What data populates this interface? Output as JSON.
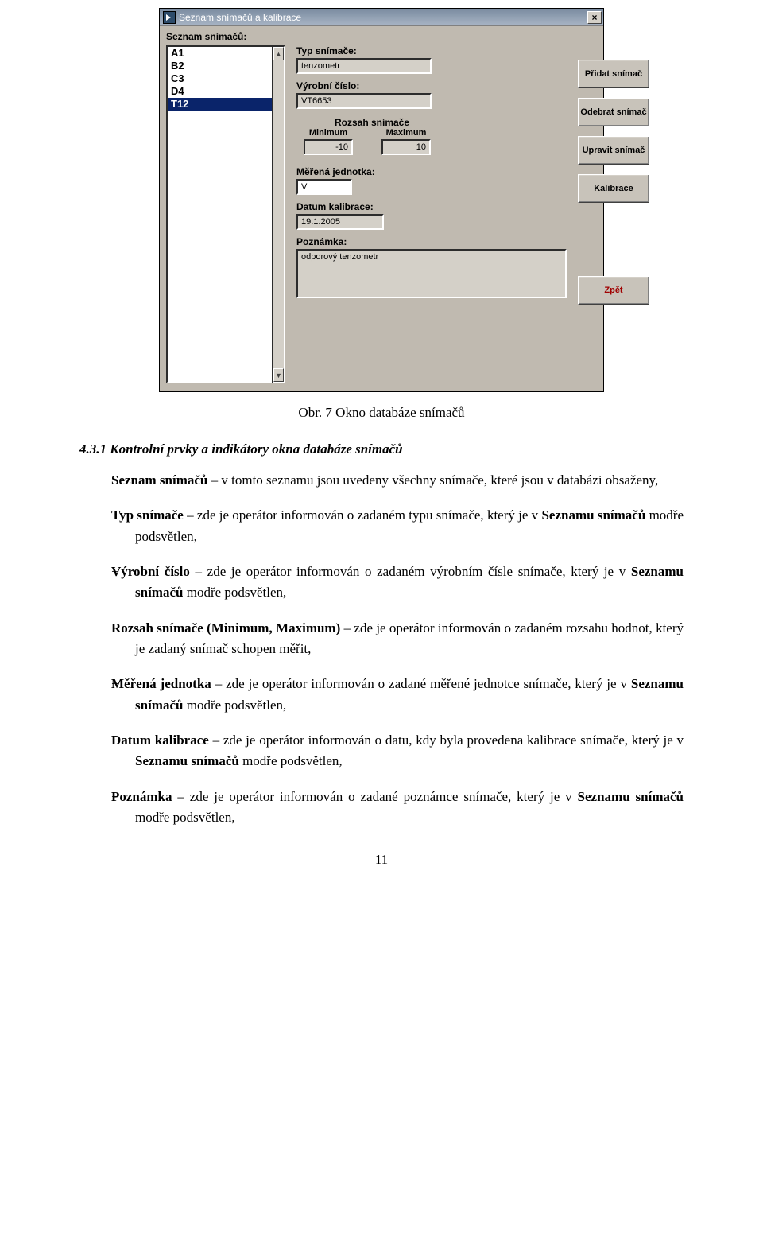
{
  "window": {
    "title": "Seznam snímačů a kalibrace",
    "close_glyph": "×",
    "list_label": "Seznam snímačů:",
    "items": [
      "A1",
      "B2",
      "C3",
      "D4",
      "T12"
    ],
    "selected_index": 4,
    "fields": {
      "typ_label": "Typ snímače:",
      "typ_value": "tenzometr",
      "vyrobni_label": "Výrobní číslo:",
      "vyrobni_value": "VT6653",
      "rozsah_label": "Rozsah snímače",
      "min_label": "Minimum",
      "max_label": "Maximum",
      "min_value": "-10",
      "max_value": "10",
      "jednotka_label": "Měřená jednotka:",
      "jednotka_value": "V",
      "datum_label": "Datum kalibrace:",
      "datum_value": "19.1.2005",
      "poznamka_label": "Poznámka:",
      "poznamka_value": "odporový tenzometr"
    },
    "buttons": {
      "pridat": "Přidat snímač",
      "odebrat": "Odebrat snímač",
      "upravit": "Upravit snímač",
      "kalibrace": "Kalibrace",
      "zpet": "Zpět"
    }
  },
  "caption": "Obr. 7  Okno databáze snímačů",
  "section_heading": "4.3.1 Kontrolní prvky a indikátory okna databáze snímačů",
  "bullets": [
    {
      "bold": "Seznam snímačů",
      "rest": " – v tomto seznamu jsou uvedeny všechny snímače, které jsou v databázi obsaženy,"
    },
    {
      "bold": "Typ snímače",
      "rest": " – zde je operátor informován o zadaném typu snímače, který je v Seznamu snímačů modře podsvětlen,"
    },
    {
      "bold": "Výrobní číslo",
      "rest": " – zde je operátor informován o zadaném výrobním čísle snímače, který je v Seznamu snímačů modře podsvětlen,"
    },
    {
      "bold": "Rozsah snímače (Minimum, Maximum)",
      "rest": " – zde je operátor informován o zadaném rozsahu hodnot, který je zadaný snímač schopen měřit,"
    },
    {
      "bold": "Měřená jednotka",
      "rest": " – zde je operátor informován o zadané měřené jednotce snímače, který je v Seznamu snímačů modře podsvětlen,"
    },
    {
      "bold": "Datum kalibrace",
      "rest": " – zde je operátor informován o datu, kdy byla provedena kalibrace snímače, který je v Seznamu snímačů modře podsvětlen,"
    },
    {
      "bold": "Poznámka",
      "rest": " – zde je operátor informován o zadané poznámce snímače, který je v Seznamu snímačů modře podsvětlen,"
    }
  ],
  "page_number": "11"
}
